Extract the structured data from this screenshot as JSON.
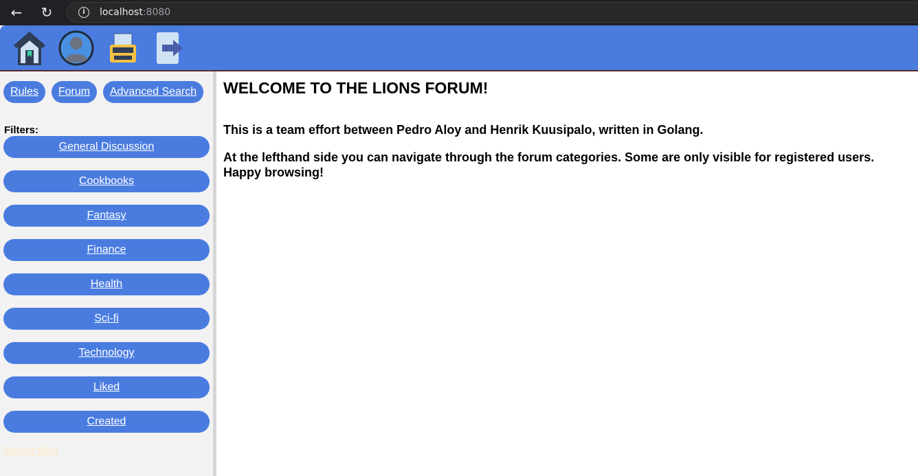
{
  "browser": {
    "url_host": "localhost",
    "url_port": ":8080"
  },
  "header": {
    "icons": [
      "home-icon",
      "profile-icon",
      "typewriter-icon",
      "logout-icon"
    ]
  },
  "sidebar": {
    "top_links": [
      "Rules",
      "Forum",
      "Advanced Search"
    ],
    "filters_label": "Filters:",
    "categories": [
      "General Discussion",
      "Cookbooks",
      "Fantasy",
      "Finance",
      "Health",
      "Sci-fi",
      "Technology",
      "Liked",
      "Created"
    ],
    "secret_link": "Secret files"
  },
  "main": {
    "title": "WELCOME TO THE LIONS FORUM!",
    "paragraph1": "This is a team effort between Pedro Aloy and Henrik Kuusipalo, written in Golang.",
    "paragraph2": "At the lefthand side you can navigate through the forum categories. Some are only visible for registered users. Happy browsing!"
  },
  "colors": {
    "accent": "#4a7ce0",
    "sidebar_bg": "#f2f2f2"
  }
}
